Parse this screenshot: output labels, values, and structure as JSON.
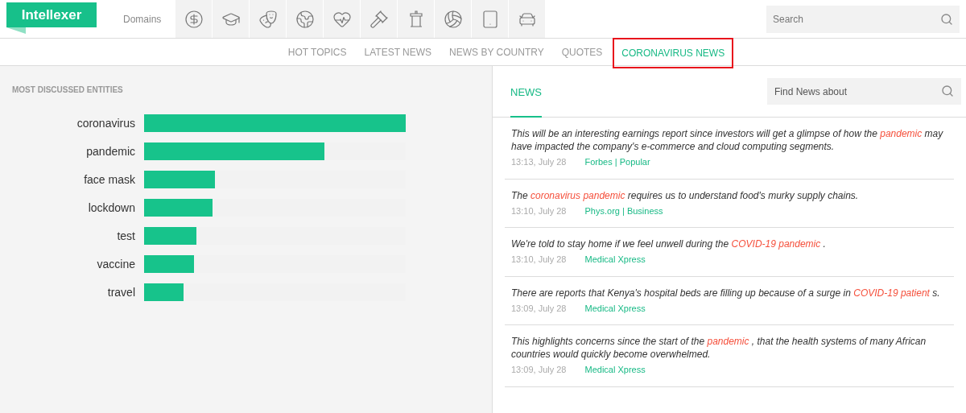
{
  "header": {
    "logo": "Intellexer",
    "domains_label": "Domains",
    "search": {
      "placeholder": "Search"
    }
  },
  "nav": [
    {
      "label": "HOT TOPICS",
      "selected": false
    },
    {
      "label": "LATEST NEWS",
      "selected": false
    },
    {
      "label": "NEWS BY COUNTRY",
      "selected": false
    },
    {
      "label": "QUOTES",
      "selected": false
    },
    {
      "label": "CORONAVIRUS NEWS",
      "selected": true
    }
  ],
  "entities": {
    "title": "MOST DISCUSSED ENTITIES",
    "items": [
      {
        "name": "coronavirus",
        "level": 1
      },
      {
        "name": "pandemic",
        "level": 0.69
      },
      {
        "name": "face mask",
        "level": 0.27
      },
      {
        "name": "lockdown",
        "level": 0.26
      },
      {
        "name": "test",
        "level": 0.2
      },
      {
        "name": "vaccine",
        "level": 0.19
      },
      {
        "name": "travel",
        "level": 0.15
      }
    ]
  },
  "news": {
    "tab": "NEWS",
    "search": {
      "placeholder": "Find News about"
    },
    "items": [
      {
        "parts": [
          {
            "text": "This will be an interesting earnings report since investors will get a glimpse of how the ",
            "highlight": false
          },
          {
            "text": "pandemic",
            "highlight": true
          },
          {
            "text": " may have impacted the company's e-commerce and cloud computing segments.",
            "highlight": false
          }
        ],
        "time": "13:13, July 28",
        "source": "Forbes | Popular"
      },
      {
        "parts": [
          {
            "text": "The ",
            "highlight": false
          },
          {
            "text": "coronavirus pandemic",
            "highlight": true
          },
          {
            "text": " requires us to understand food's murky supply chains.",
            "highlight": false
          }
        ],
        "time": "13:10, July 28",
        "source": "Phys.org | Business"
      },
      {
        "parts": [
          {
            "text": "We're told to stay home if we feel unwell during the ",
            "highlight": false
          },
          {
            "text": "COVID-19 pandemic",
            "highlight": true
          },
          {
            "text": " .",
            "highlight": false
          }
        ],
        "time": "13:10, July 28",
        "source": "Medical Xpress"
      },
      {
        "parts": [
          {
            "text": "There are reports that Kenya's hospital beds are filling up because of a surge in ",
            "highlight": false
          },
          {
            "text": "COVID-19 patient",
            "highlight": true
          },
          {
            "text": " s.",
            "highlight": false
          }
        ],
        "time": "13:09, July 28",
        "source": "Medical Xpress"
      },
      {
        "parts": [
          {
            "text": "This highlights concerns since the start of the ",
            "highlight": false
          },
          {
            "text": "pandemic",
            "highlight": true
          },
          {
            "text": " , that the health systems of many African countries would quickly become overwhelmed.",
            "highlight": false
          }
        ],
        "time": "13:09, July 28",
        "source": "Medical Xpress"
      }
    ]
  }
}
